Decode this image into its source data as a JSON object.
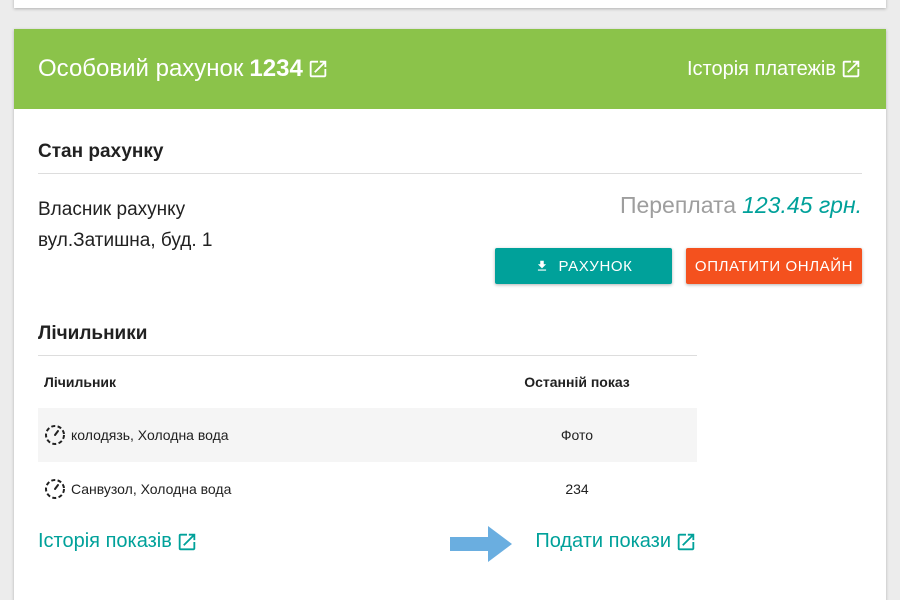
{
  "header": {
    "title_prefix": "Особовий рахунок",
    "account_number": "1234",
    "payments_history": "Історія платежів"
  },
  "state": {
    "title": "Стан рахунку",
    "owner_label": "Власник рахунку",
    "address": "вул.Затишна, буд. 1",
    "balance_label": "Переплата",
    "balance_amount": "123.45 грн.",
    "invoice_button": "Рахунок",
    "pay_button": "Оплатити онлайн"
  },
  "meters": {
    "title": "Лічильники",
    "col_meter": "Лічильник",
    "col_last": "Останній показ",
    "rows": [
      {
        "name": "колодязь, Холодна вода",
        "last": "Фото"
      },
      {
        "name": "Санвузол, Холодна вода",
        "last": "234"
      }
    ],
    "history_link": "Історія показів",
    "submit_link": "Подати покази"
  },
  "colors": {
    "header_green": "#8bc34a",
    "teal": "#00a19a",
    "orange": "#f4511e",
    "arrow_blue": "#6aaee0"
  }
}
